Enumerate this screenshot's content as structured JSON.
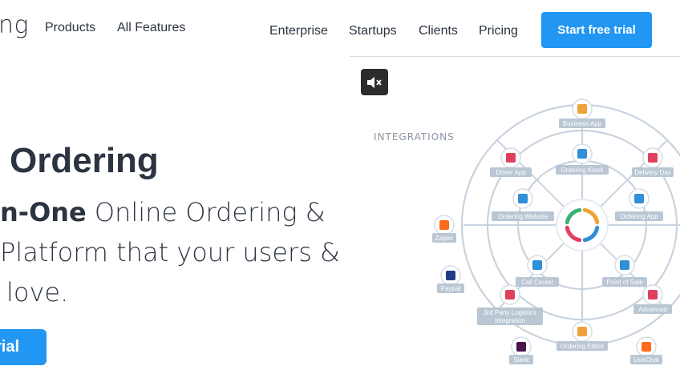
{
  "header": {
    "logo_text": "ng",
    "nav_left": [
      "Products",
      "All Features"
    ],
    "nav_right": [
      "Enterprise",
      "Startups",
      "Clients",
      "Pricing"
    ],
    "cta_label": "Start free trial"
  },
  "hero": {
    "title": "Ordering",
    "line1_bold": "n-One",
    "line1_rest": " Online Ordering &",
    "line2": "Platform that your users &",
    "line3": "love.",
    "cta_label": "rial"
  },
  "media": {
    "mute_icon": "speaker-mute-icon"
  },
  "diagram": {
    "heading": "INTEGRATIONS",
    "nodes": [
      {
        "label": "Business App",
        "icon": "list-icon",
        "color": "#f0a23a"
      },
      {
        "label": "Ordering Kiosk",
        "icon": "kiosk-icon",
        "color": "#2f8fd8"
      },
      {
        "label": "Driver App",
        "icon": "truck-icon",
        "color": "#e0405e"
      },
      {
        "label": "Delivery Das",
        "icon": "dashboard-icon",
        "color": "#e0405e"
      },
      {
        "label": "Ordering Website",
        "icon": "browser-icon",
        "color": "#2f8fd8"
      },
      {
        "label": "Ordering App",
        "icon": "phone-icon",
        "color": "#2f8fd8"
      },
      {
        "label": "Zapier",
        "icon": "zapier-icon",
        "color": "#ff6b1a"
      },
      {
        "label": "Call Center",
        "icon": "headset-icon",
        "color": "#2f8fd8"
      },
      {
        "label": "Point of Sale",
        "icon": "pos-icon",
        "color": "#2f8fd8"
      },
      {
        "label": "Paypal",
        "icon": "paypal-icon",
        "color": "#1f3b8a"
      },
      {
        "label": "3rd Party Logistics Integration",
        "icon": "delivery-truck-icon",
        "color": "#e0405e"
      },
      {
        "label": "Advanced",
        "icon": "advanced-truck-icon",
        "color": "#e0405e"
      },
      {
        "label": "Ordering Editor",
        "icon": "editor-icon",
        "color": "#f0a23a"
      },
      {
        "label": "Slack",
        "icon": "slack-icon",
        "color": "#4a154b"
      },
      {
        "label": "LiveChat",
        "icon": "chat-icon",
        "color": "#ff6b1a"
      }
    ]
  }
}
